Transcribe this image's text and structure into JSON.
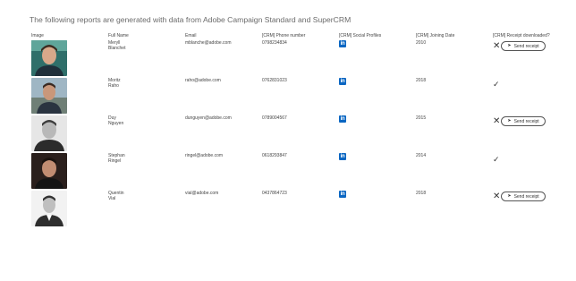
{
  "heading": "The following reports are generated with data from Adobe Campaign Standard and SuperCRM",
  "columns": {
    "image": "Image",
    "full_name": "Full Name",
    "email": "Email",
    "phone": "[CRM] Phone number",
    "social": "[CRM] Social Profiles",
    "joining": "[CRM] Joining Date",
    "receipt": "[CRM] Receipt downloaded?"
  },
  "icons": {
    "social": "linkedin-icon",
    "not_downloaded": "x-icon",
    "downloaded": "checkmark-icon",
    "send": "paper-plane-icon"
  },
  "colors": {
    "linkedin": "#0a66c2"
  },
  "linkedin_glyph": "in",
  "send_label": "Send receipt",
  "rows": [
    {
      "first": "Meryll",
      "last": "Blanchet",
      "email": "mblanche@adobe.com",
      "phone": "0798234834",
      "joining": "2010",
      "receipt_downloaded": false
    },
    {
      "first": "Moritz",
      "last": "Raho",
      "email": "raho@adobe.com",
      "phone": "0762831023",
      "joining": "2018",
      "receipt_downloaded": true
    },
    {
      "first": "Duy",
      "last": "Nguyen",
      "email": "dunguyen@adobe.com",
      "phone": "0789004567",
      "joining": "2015",
      "receipt_downloaded": false
    },
    {
      "first": "Stephan",
      "last": "Ringel",
      "email": "ringel@adobe.com",
      "phone": "0618293847",
      "joining": "2014",
      "receipt_downloaded": true
    },
    {
      "first": "Quentin",
      "last": "Vial",
      "email": "vial@adobe.com",
      "phone": "0437864723",
      "joining": "2018",
      "receipt_downloaded": false
    }
  ]
}
